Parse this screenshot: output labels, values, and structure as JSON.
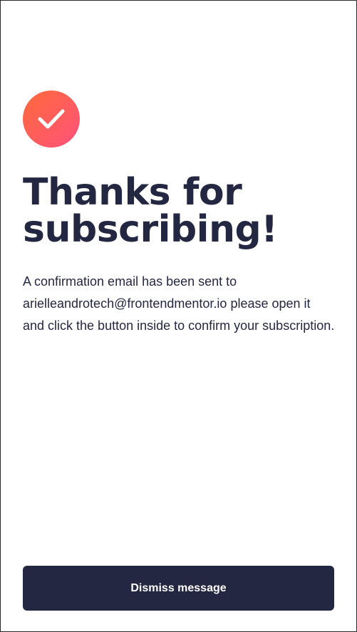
{
  "success": {
    "icon": "checkmark-icon",
    "title": "Thanks for subscribing!",
    "message_before": "A confirmation email has been sent to ",
    "email": "arielleandrotech@frontendmentor.io",
    "message_after": " please open it and click the button inside to confirm your subscription."
  },
  "actions": {
    "dismiss_label": "Dismiss message"
  },
  "colors": {
    "text": "#242742",
    "button_bg": "#242742",
    "icon_gradient_start": "#ff6a3a",
    "icon_gradient_end": "#ff527b"
  }
}
